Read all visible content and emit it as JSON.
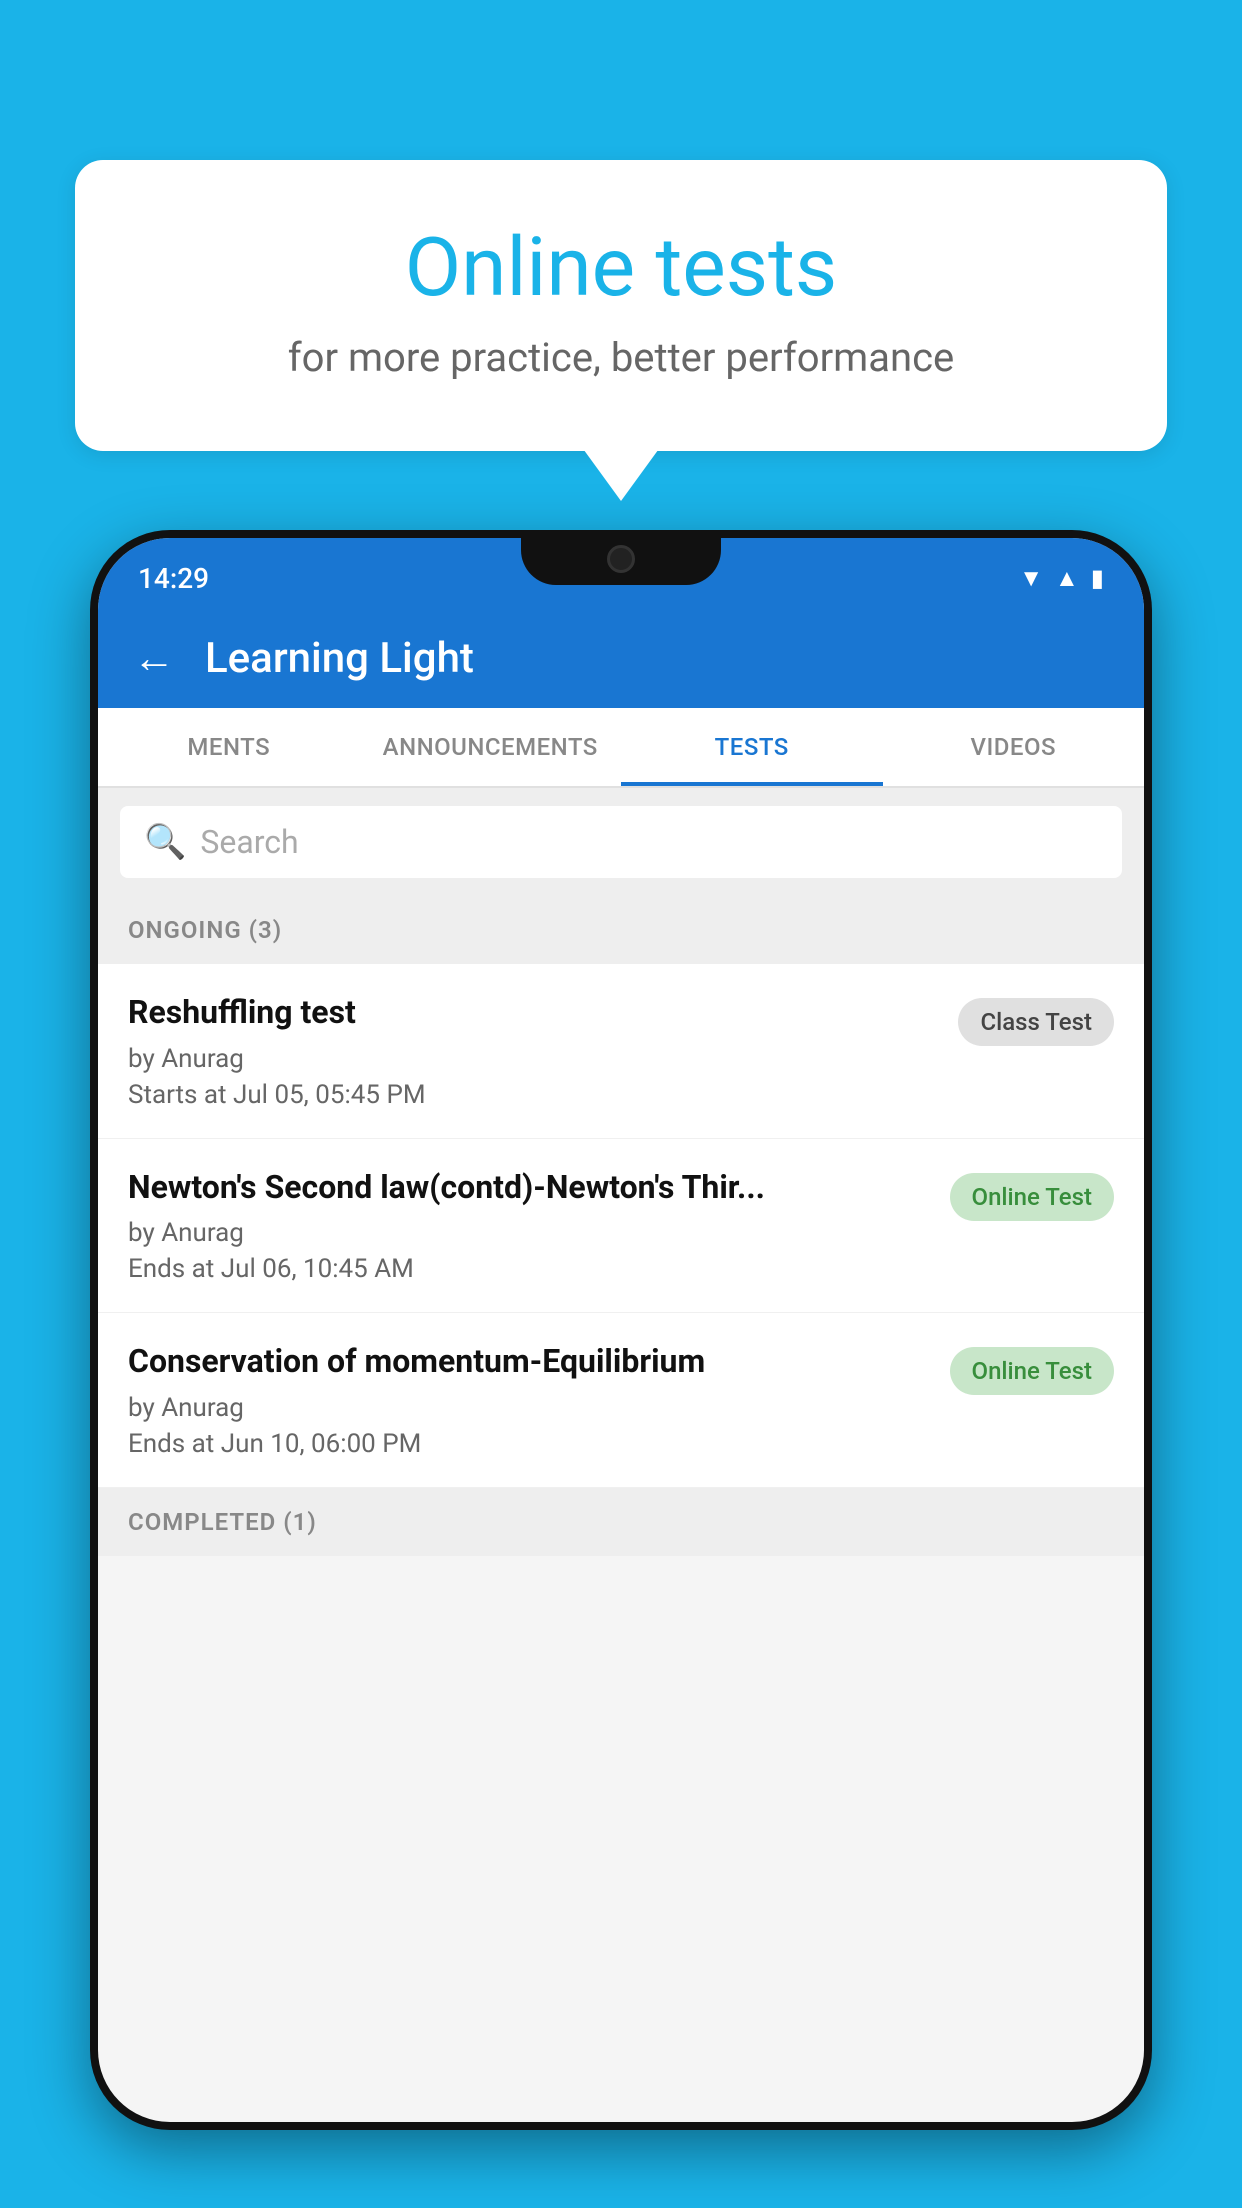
{
  "background_color": "#1ab3e8",
  "bubble": {
    "title": "Online tests",
    "subtitle": "for more practice, better performance"
  },
  "status_bar": {
    "time": "14:29",
    "wifi_icon": "▼",
    "signal_icon": "▲",
    "battery_icon": "▮"
  },
  "app_bar": {
    "back_label": "←",
    "title": "Learning Light"
  },
  "tabs": [
    {
      "label": "MENTS",
      "active": false
    },
    {
      "label": "ANNOUNCEMENTS",
      "active": false
    },
    {
      "label": "TESTS",
      "active": true
    },
    {
      "label": "VIDEOS",
      "active": false
    }
  ],
  "search": {
    "placeholder": "Search"
  },
  "ongoing_section": {
    "label": "ONGOING (3)"
  },
  "test_items": [
    {
      "title": "Reshuffling test",
      "author": "by Anurag",
      "time": "Starts at  Jul 05, 05:45 PM",
      "badge": "Class Test",
      "badge_type": "class"
    },
    {
      "title": "Newton's Second law(contd)-Newton's Thir...",
      "author": "by Anurag",
      "time": "Ends at  Jul 06, 10:45 AM",
      "badge": "Online Test",
      "badge_type": "online"
    },
    {
      "title": "Conservation of momentum-Equilibrium",
      "author": "by Anurag",
      "time": "Ends at  Jun 10, 06:00 PM",
      "badge": "Online Test",
      "badge_type": "online"
    }
  ],
  "completed_section": {
    "label": "COMPLETED (1)"
  }
}
